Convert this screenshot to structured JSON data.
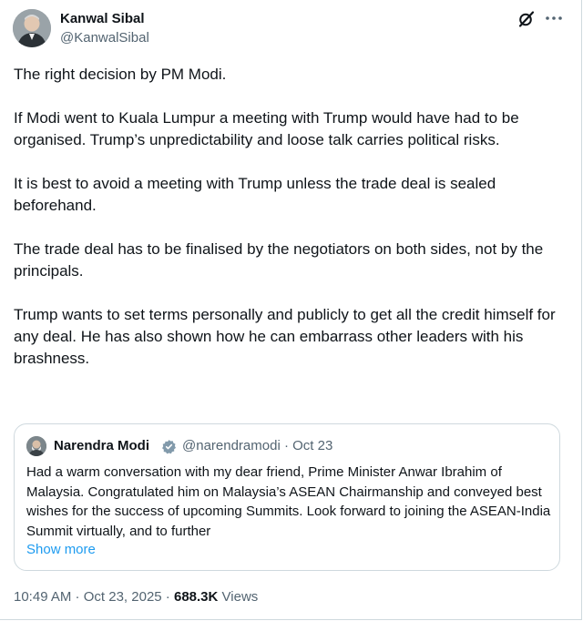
{
  "author": {
    "name": "Kanwal Sibal",
    "handle": "@KanwalSibal"
  },
  "tweet": {
    "paragraphs": [
      "The right decision by PM Modi.",
      "If Modi went to Kuala Lumpur a meeting with Trump would have had to be organised. Trump’s unpredictability and loose talk carries political risks.",
      "It is best to avoid a meeting with Trump unless the trade deal is sealed beforehand.",
      "The trade deal has to be finalised by the negotiators on both sides, not by the principals.",
      "Trump wants to set terms personally and publicly to get all the credit himself for any deal. He has also shown how he can embarrass other leaders with his brashness."
    ],
    "time": "10:49 AM",
    "separator": " · ",
    "date": "Oct 23, 2025",
    "views_count": "688.3K",
    "views_label": "Views"
  },
  "quote": {
    "name": "Narendra Modi",
    "handle": "@narendramodi",
    "separator": " · ",
    "date": "Oct 23",
    "text": "Had a warm conversation with my dear friend, Prime Minister Anwar Ibrahim of Malaysia. Congratulated him on Malaysia’s ASEAN Chairmanship and conveyed best wishes for the success of upcoming Summits. Look forward to joining the ASEAN-India Summit virtually, and to further",
    "show_more": "Show more"
  },
  "icons": {
    "grok": "grok-icon",
    "more": "more-options-icon",
    "verified": "verified-badge-icon"
  },
  "colors": {
    "link": "#1d9bf0",
    "secondary_text": "#536471",
    "primary_text": "#0f1419",
    "border": "#cfd9de"
  }
}
